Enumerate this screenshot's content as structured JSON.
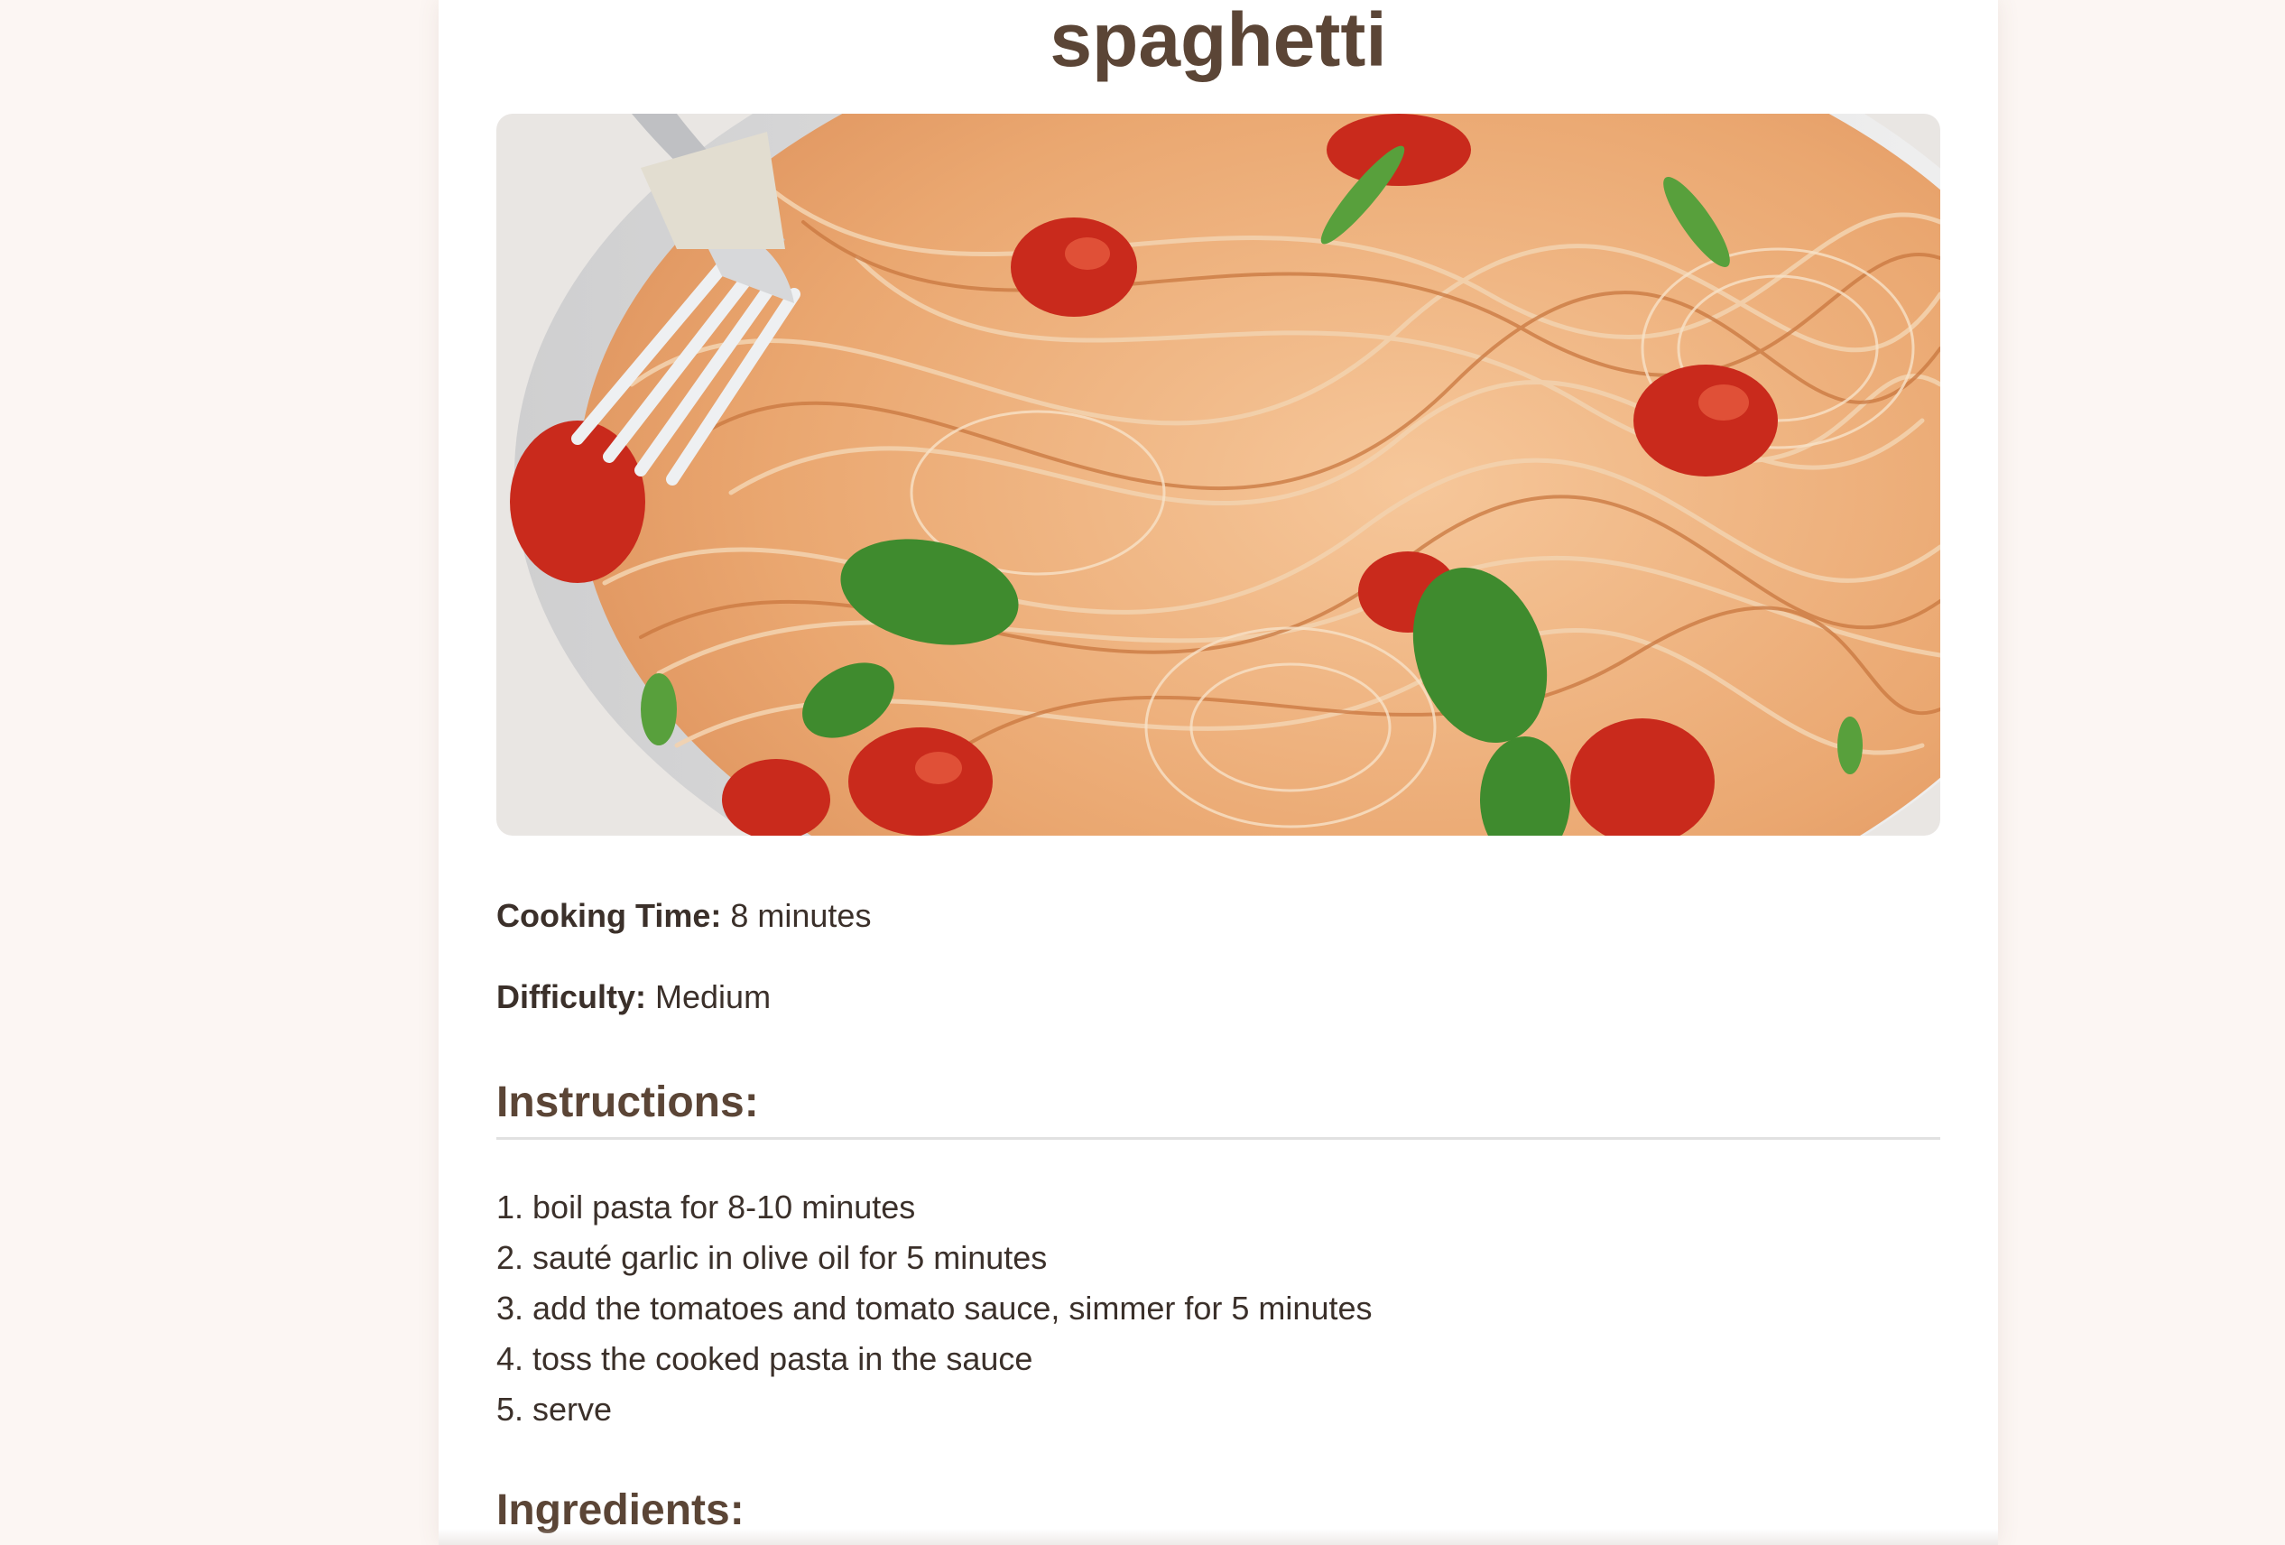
{
  "recipe": {
    "title": "spaghetti",
    "cooking_time_label": "Cooking Time:",
    "cooking_time_value": "8 minutes",
    "difficulty_label": "Difficulty:",
    "difficulty_value": "Medium"
  },
  "instructions": {
    "heading": "Instructions:",
    "steps": [
      "1. boil pasta for 8-10 minutes",
      "2. sauté garlic in olive oil for 5 minutes",
      "3. add the tomatoes and tomato sauce, simmer for 5 minutes",
      "4. toss the cooked pasta in the sauce",
      "5. serve"
    ]
  },
  "ingredients": {
    "heading": "Ingredients:"
  },
  "colors": {
    "page_background": "#fcf6f3",
    "card_background": "#ffffff",
    "heading_brown": "#5b4536",
    "body_text": "#3b302a"
  }
}
